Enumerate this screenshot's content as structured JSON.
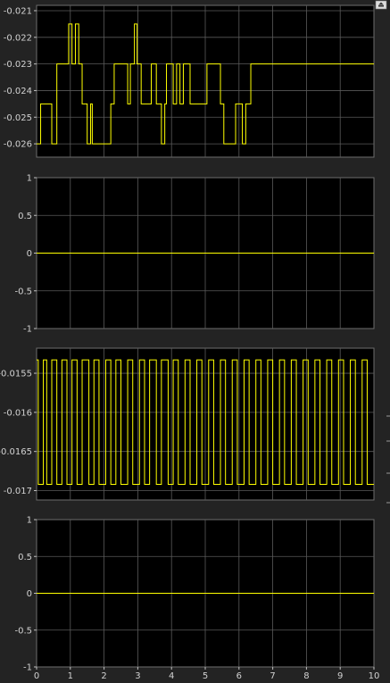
{
  "colors": {
    "background": "#232323",
    "axes": "#000000",
    "grid": "#5a5a5a",
    "trace": "#ffff00",
    "text": "#d2d2d2"
  },
  "toolbar": {
    "restore_icon": "restore-window-icon"
  },
  "chart_data": [
    {
      "type": "line",
      "xlim": [
        0,
        10
      ],
      "ylim": [
        -0.0265,
        -0.0208
      ],
      "yticks": [
        "-0.021",
        "-0.022",
        "-0.023",
        "-0.024",
        "-0.025",
        "-0.026"
      ],
      "yticks_values": [
        -0.021,
        -0.022,
        -0.023,
        -0.024,
        -0.025,
        -0.026
      ],
      "grid": true,
      "levels": [
        -0.0215,
        -0.023,
        -0.0245,
        -0.026
      ],
      "series": [
        {
          "x": [
            0,
            0.12,
            0.12,
            0.45,
            0.45,
            0.6,
            0.6,
            0.95,
            0.95,
            1.05,
            1.05,
            1.15,
            1.15,
            1.25,
            1.25,
            1.35,
            1.35,
            1.5,
            1.5,
            1.6,
            1.6,
            1.65,
            1.65,
            2.2,
            2.2,
            2.3,
            2.3,
            2.7,
            2.7,
            2.78,
            2.78,
            2.9,
            2.9,
            2.98,
            2.98,
            3.1,
            3.1,
            3.4,
            3.4,
            3.55,
            3.55,
            3.7,
            3.7,
            3.8,
            3.8,
            3.85,
            3.85,
            4.05,
            4.05,
            4.15,
            4.15,
            4.25,
            4.25,
            4.35,
            4.35,
            4.55,
            4.55,
            5.05,
            5.05,
            5.45,
            5.45,
            5.55,
            5.55,
            5.9,
            5.9,
            6.1,
            6.1,
            6.2,
            6.2,
            6.35,
            6.35,
            10
          ],
          "y": [
            -0.026,
            -0.026,
            -0.0245,
            -0.0245,
            -0.026,
            -0.026,
            -0.023,
            -0.023,
            -0.0215,
            -0.0215,
            -0.023,
            -0.023,
            -0.0215,
            -0.0215,
            -0.023,
            -0.023,
            -0.0245,
            -0.0245,
            -0.026,
            -0.026,
            -0.0245,
            -0.0245,
            -0.026,
            -0.026,
            -0.0245,
            -0.0245,
            -0.023,
            -0.023,
            -0.0245,
            -0.0245,
            -0.023,
            -0.023,
            -0.0215,
            -0.0215,
            -0.023,
            -0.023,
            -0.0245,
            -0.0245,
            -0.023,
            -0.023,
            -0.0245,
            -0.0245,
            -0.026,
            -0.026,
            -0.0245,
            -0.0245,
            -0.023,
            -0.023,
            -0.0245,
            -0.0245,
            -0.023,
            -0.023,
            -0.0245,
            -0.0245,
            -0.023,
            -0.023,
            -0.0245,
            -0.0245,
            -0.023,
            -0.023,
            -0.0245,
            -0.0245,
            -0.026,
            -0.026,
            -0.0245,
            -0.0245,
            -0.026,
            -0.026,
            -0.0245,
            -0.0245,
            -0.023,
            -0.023
          ]
        }
      ]
    },
    {
      "type": "line",
      "xlim": [
        0,
        10
      ],
      "ylim": [
        -1,
        1
      ],
      "yticks": [
        "1",
        "0.5",
        "0",
        "-0.5",
        "-1"
      ],
      "yticks_values": [
        1,
        0.5,
        0,
        -0.5,
        -1
      ],
      "grid": true,
      "series": [
        {
          "x": [
            0,
            10
          ],
          "y": [
            0,
            0
          ]
        }
      ]
    },
    {
      "type": "line",
      "xlim": [
        0,
        10
      ],
      "ylim": [
        -0.01712,
        -0.01518
      ],
      "yticks": [
        "-0.0155",
        "-0.016",
        "-0.0165",
        "-0.017"
      ],
      "yticks_values": [
        -0.0155,
        -0.016,
        -0.0165,
        -0.017
      ],
      "grid": true,
      "levels": [
        -0.01533,
        -0.01692
      ],
      "series": [
        {
          "x": [
            0,
            0.05,
            0.05,
            0.2,
            0.2,
            0.3,
            0.3,
            0.45,
            0.45,
            0.6,
            0.6,
            0.75,
            0.75,
            0.9,
            0.9,
            1.05,
            1.05,
            1.2,
            1.2,
            1.35,
            1.35,
            1.55,
            1.55,
            1.7,
            1.7,
            1.85,
            1.85,
            2.05,
            2.05,
            2.2,
            2.2,
            2.35,
            2.35,
            2.5,
            2.5,
            2.7,
            2.7,
            2.85,
            2.85,
            3.05,
            3.05,
            3.2,
            3.2,
            3.35,
            3.35,
            3.55,
            3.55,
            3.7,
            3.7,
            3.9,
            3.9,
            4.05,
            4.05,
            4.2,
            4.2,
            4.4,
            4.4,
            4.55,
            4.55,
            4.75,
            4.75,
            4.9,
            4.9,
            5.1,
            5.1,
            5.25,
            5.25,
            5.45,
            5.45,
            5.6,
            5.6,
            5.8,
            5.8,
            5.95,
            5.95,
            6.15,
            6.15,
            6.3,
            6.3,
            6.5,
            6.5,
            6.65,
            6.65,
            6.85,
            6.85,
            7.0,
            7.0,
            7.2,
            7.2,
            7.35,
            7.35,
            7.55,
            7.55,
            7.7,
            7.7,
            7.9,
            7.9,
            8.05,
            8.05,
            8.25,
            8.25,
            8.4,
            8.4,
            8.6,
            8.6,
            8.75,
            8.75,
            8.95,
            8.95,
            9.1,
            9.1,
            9.3,
            9.3,
            9.45,
            9.45,
            9.65,
            9.65,
            9.8,
            9.8,
            10
          ],
          "y": [
            -0.01533,
            -0.01533,
            -0.01692,
            -0.01692,
            -0.01533,
            -0.01533,
            -0.01692,
            -0.01692,
            -0.01533,
            -0.01533,
            -0.01692,
            -0.01692,
            -0.01533,
            -0.01533,
            -0.01692,
            -0.01692,
            -0.01533,
            -0.01533,
            -0.01692,
            -0.01692,
            -0.01533,
            -0.01533,
            -0.01692,
            -0.01692,
            -0.01533,
            -0.01533,
            -0.01692,
            -0.01692,
            -0.01533,
            -0.01533,
            -0.01692,
            -0.01692,
            -0.01533,
            -0.01533,
            -0.01692,
            -0.01692,
            -0.01533,
            -0.01533,
            -0.01692,
            -0.01692,
            -0.01533,
            -0.01533,
            -0.01692,
            -0.01692,
            -0.01533,
            -0.01533,
            -0.01692,
            -0.01692,
            -0.01533,
            -0.01533,
            -0.01692,
            -0.01692,
            -0.01533,
            -0.01533,
            -0.01692,
            -0.01692,
            -0.01533,
            -0.01533,
            -0.01692,
            -0.01692,
            -0.01533,
            -0.01533,
            -0.01692,
            -0.01692,
            -0.01533,
            -0.01533,
            -0.01692,
            -0.01692,
            -0.01533,
            -0.01533,
            -0.01692,
            -0.01692,
            -0.01533,
            -0.01533,
            -0.01692,
            -0.01692,
            -0.01533,
            -0.01533,
            -0.01692,
            -0.01692,
            -0.01533,
            -0.01533,
            -0.01692,
            -0.01692,
            -0.01533,
            -0.01533,
            -0.01692,
            -0.01692,
            -0.01533,
            -0.01533,
            -0.01692,
            -0.01692,
            -0.01533,
            -0.01533,
            -0.01692,
            -0.01692,
            -0.01533,
            -0.01533,
            -0.01692,
            -0.01692,
            -0.01533,
            -0.01533,
            -0.01692,
            -0.01692,
            -0.01533,
            -0.01533,
            -0.01692,
            -0.01692,
            -0.01533,
            -0.01533,
            -0.01692,
            -0.01692,
            -0.01533,
            -0.01533,
            -0.01692,
            -0.01692,
            -0.01533,
            -0.01533,
            -0.01692,
            -0.01692
          ]
        }
      ]
    },
    {
      "type": "line",
      "xlim": [
        0,
        10
      ],
      "ylim": [
        -1,
        1
      ],
      "yticks": [
        "1",
        "0.5",
        "0",
        "-0.5",
        "-1"
      ],
      "yticks_values": [
        1,
        0.5,
        0,
        -0.5,
        -1
      ],
      "xticks": [
        "0",
        "1",
        "2",
        "3",
        "4",
        "5",
        "6",
        "7",
        "8",
        "9",
        "10"
      ],
      "xticks_values": [
        0,
        1,
        2,
        3,
        4,
        5,
        6,
        7,
        8,
        9,
        10
      ],
      "grid": true,
      "series": [
        {
          "x": [
            0,
            10
          ],
          "y": [
            0,
            0
          ]
        }
      ]
    }
  ]
}
